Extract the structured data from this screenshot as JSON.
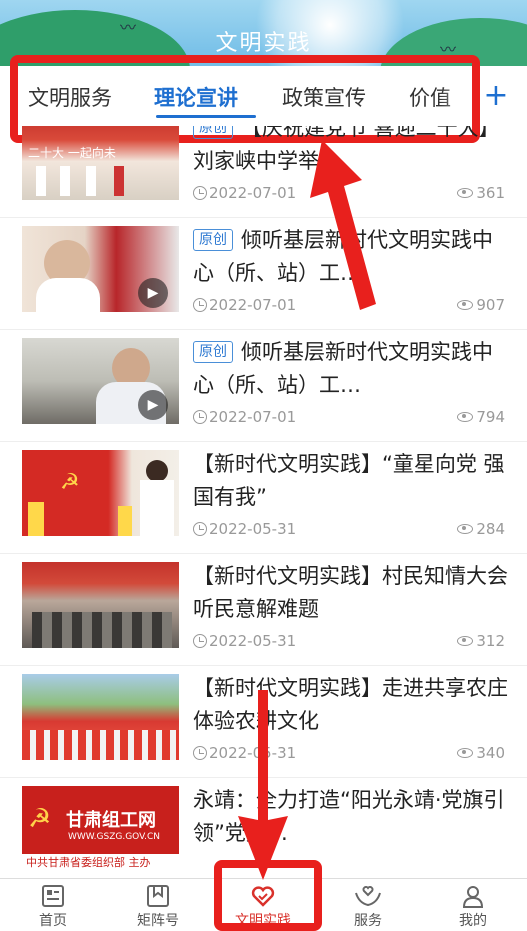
{
  "header": {
    "title": "文明实践"
  },
  "tabs": {
    "items": [
      {
        "label": "文明服务"
      },
      {
        "label": "理论宣讲"
      },
      {
        "label": "政策宣传"
      },
      {
        "label": "价值"
      }
    ],
    "active": "理论宣讲",
    "add_icon": "plus-icon",
    "accent": "#1e6fd0"
  },
  "feed": [
    {
      "tag": "原创",
      "title": "【庆祝建党节 喜迎二十大】刘家峡中学举…",
      "date": "2022-07-01",
      "views": "361",
      "video": false
    },
    {
      "tag": "原创",
      "title": "倾听基层新时代文明实践中心（所、站）工…",
      "date": "2022-07-01",
      "views": "907",
      "video": true
    },
    {
      "tag": "原创",
      "title": "倾听基层新时代文明实践中心（所、站）工…",
      "date": "2022-07-01",
      "views": "794",
      "video": true
    },
    {
      "tag": "",
      "title": "【新时代文明实践】“童星向党 强国有我”",
      "date": "2022-05-31",
      "views": "284",
      "video": false
    },
    {
      "tag": "",
      "title": "【新时代文明实践】村民知情大会听民意解难题",
      "date": "2022-05-31",
      "views": "312",
      "video": false
    },
    {
      "tag": "",
      "title": "【新时代文明实践】走进共享农庄 体验农耕文化",
      "date": "2022-05-31",
      "views": "340",
      "video": false
    },
    {
      "tag": "",
      "title": "永靖：全力打造“阳光永靖·党旗引领”党建…",
      "date": "",
      "views": "",
      "video": false
    }
  ],
  "thumb_texts": {
    "t1": "二十大 一起向未",
    "t7_logo": "甘肃组工网",
    "t7_url": "WWW.GSZG.GOV.CN",
    "t7_org": "中共甘肃省委组织部 主办"
  },
  "nav": {
    "items": [
      {
        "label": "首页",
        "icon": "news-icon"
      },
      {
        "label": "矩阵号",
        "icon": "bookmark-icon"
      },
      {
        "label": "文明实践",
        "icon": "heart-icon"
      },
      {
        "label": "服务",
        "icon": "hands-heart-icon"
      },
      {
        "label": "我的",
        "icon": "user-icon"
      }
    ],
    "active": "文明实践",
    "active_color": "#d9312b"
  },
  "annotation_color": "#e8201d"
}
